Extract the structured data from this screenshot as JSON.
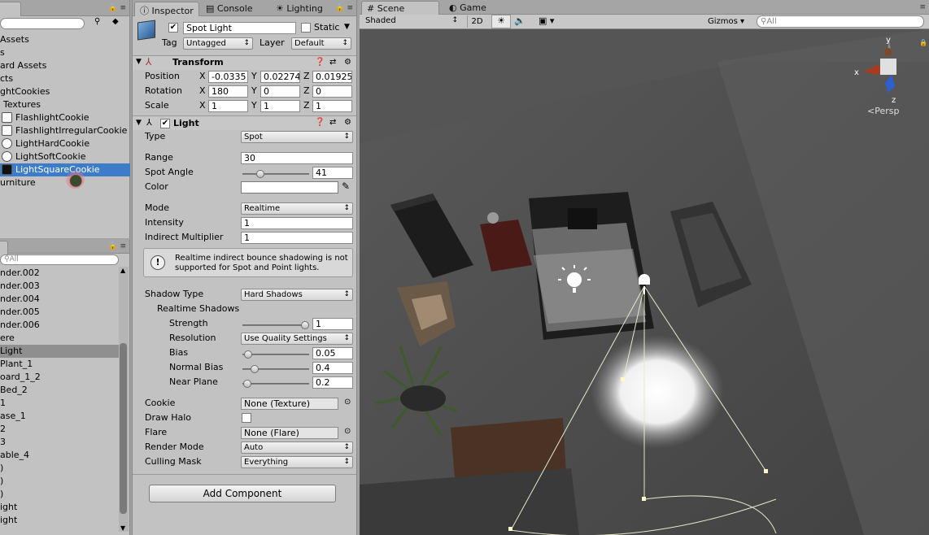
{
  "project": {
    "items": [
      {
        "label": "Assets"
      },
      {
        "label": "s"
      },
      {
        "label": "ard Assets"
      },
      {
        "label": "cts"
      },
      {
        "label": "ghtCookies"
      },
      {
        "label": "Textures"
      },
      {
        "label": "FlashlightCookie"
      },
      {
        "label": "FlashlightIrregularCookie"
      },
      {
        "label": "LightHardCookie"
      },
      {
        "label": "LightSoftCookie"
      },
      {
        "label": "LightSquareCookie"
      },
      {
        "label": "urniture"
      }
    ]
  },
  "hierarchy": {
    "search_placeholder": "All",
    "items": [
      {
        "label": "nder.002"
      },
      {
        "label": "nder.003"
      },
      {
        "label": "nder.004"
      },
      {
        "label": "nder.005"
      },
      {
        "label": "nder.006"
      },
      {
        "label": "ere"
      },
      {
        "label": "Light"
      },
      {
        "label": "Plant_1"
      },
      {
        "label": "oard_1_2"
      },
      {
        "label": "Bed_2"
      },
      {
        "label": "1"
      },
      {
        "label": "ase_1"
      },
      {
        "label": "2"
      },
      {
        "label": "3"
      },
      {
        "label": "able_4"
      },
      {
        "label": ")"
      },
      {
        "label": ")"
      },
      {
        "label": ")"
      },
      {
        "label": "ight"
      },
      {
        "label": "ight"
      }
    ]
  },
  "inspector": {
    "tabs": [
      "Inspector",
      "Console",
      "Lighting"
    ],
    "object_name": "Spot Light",
    "static_label": "Static",
    "tag_label": "Tag",
    "tag_value": "Untagged",
    "layer_label": "Layer",
    "layer_value": "Default",
    "transform": {
      "title": "Transform",
      "position_label": "Position",
      "rotation_label": "Rotation",
      "scale_label": "Scale",
      "px": "-0.0335",
      "py": "0.02274",
      "pz": "0.01925",
      "rx": "180",
      "ry": "0",
      "rz": "0",
      "sx": "1",
      "sy": "1",
      "sz": "1"
    },
    "light": {
      "title": "Light",
      "type_label": "Type",
      "type_value": "Spot",
      "range_label": "Range",
      "range_value": "30",
      "spot_angle_label": "Spot Angle",
      "spot_angle_value": "41",
      "spot_angle_fraction": 0.24,
      "color_label": "Color",
      "mode_label": "Mode",
      "mode_value": "Realtime",
      "intensity_label": "Intensity",
      "intensity_value": "1",
      "indirect_label": "Indirect Multiplier",
      "indirect_value": "1",
      "info_text_1": "Realtime indirect bounce shadowing is not",
      "info_text_2": "supported for Spot and Point lights.",
      "shadow_type_label": "Shadow Type",
      "shadow_type_value": "Hard Shadows",
      "realtime_shadows_label": "Realtime Shadows",
      "strength_label": "Strength",
      "strength_value": "1",
      "strength_fraction": 1.0,
      "resolution_label": "Resolution",
      "resolution_value": "Use Quality Settings",
      "bias_label": "Bias",
      "bias_value": "0.05",
      "bias_fraction": 0.025,
      "normal_bias_label": "Normal Bias",
      "normal_bias_value": "0.4",
      "normal_bias_fraction": 0.133,
      "near_plane_label": "Near Plane",
      "near_plane_value": "0.2",
      "near_plane_fraction": 0.02,
      "cookie_label": "Cookie",
      "cookie_value": "None (Texture)",
      "draw_halo_label": "Draw Halo",
      "flare_label": "Flare",
      "flare_value": "None (Flare)",
      "render_mode_label": "Render Mode",
      "render_mode_value": "Auto",
      "culling_mask_label": "Culling Mask",
      "culling_mask_value": "Everything"
    },
    "add_component": "Add Component"
  },
  "scene": {
    "tabs": [
      "Scene",
      "Game"
    ],
    "shading": "Shaded",
    "mode_2d": "2D",
    "gizmos": "Gizmos",
    "search_placeholder": "All",
    "gizmo_y": "y",
    "gizmo_x": "x",
    "gizmo_z": "z",
    "persp": "Persp"
  },
  "colors": {
    "selection": "#3d7cc9",
    "panel": "#c2c2c2",
    "scene_bg": "#4c4c4c"
  }
}
